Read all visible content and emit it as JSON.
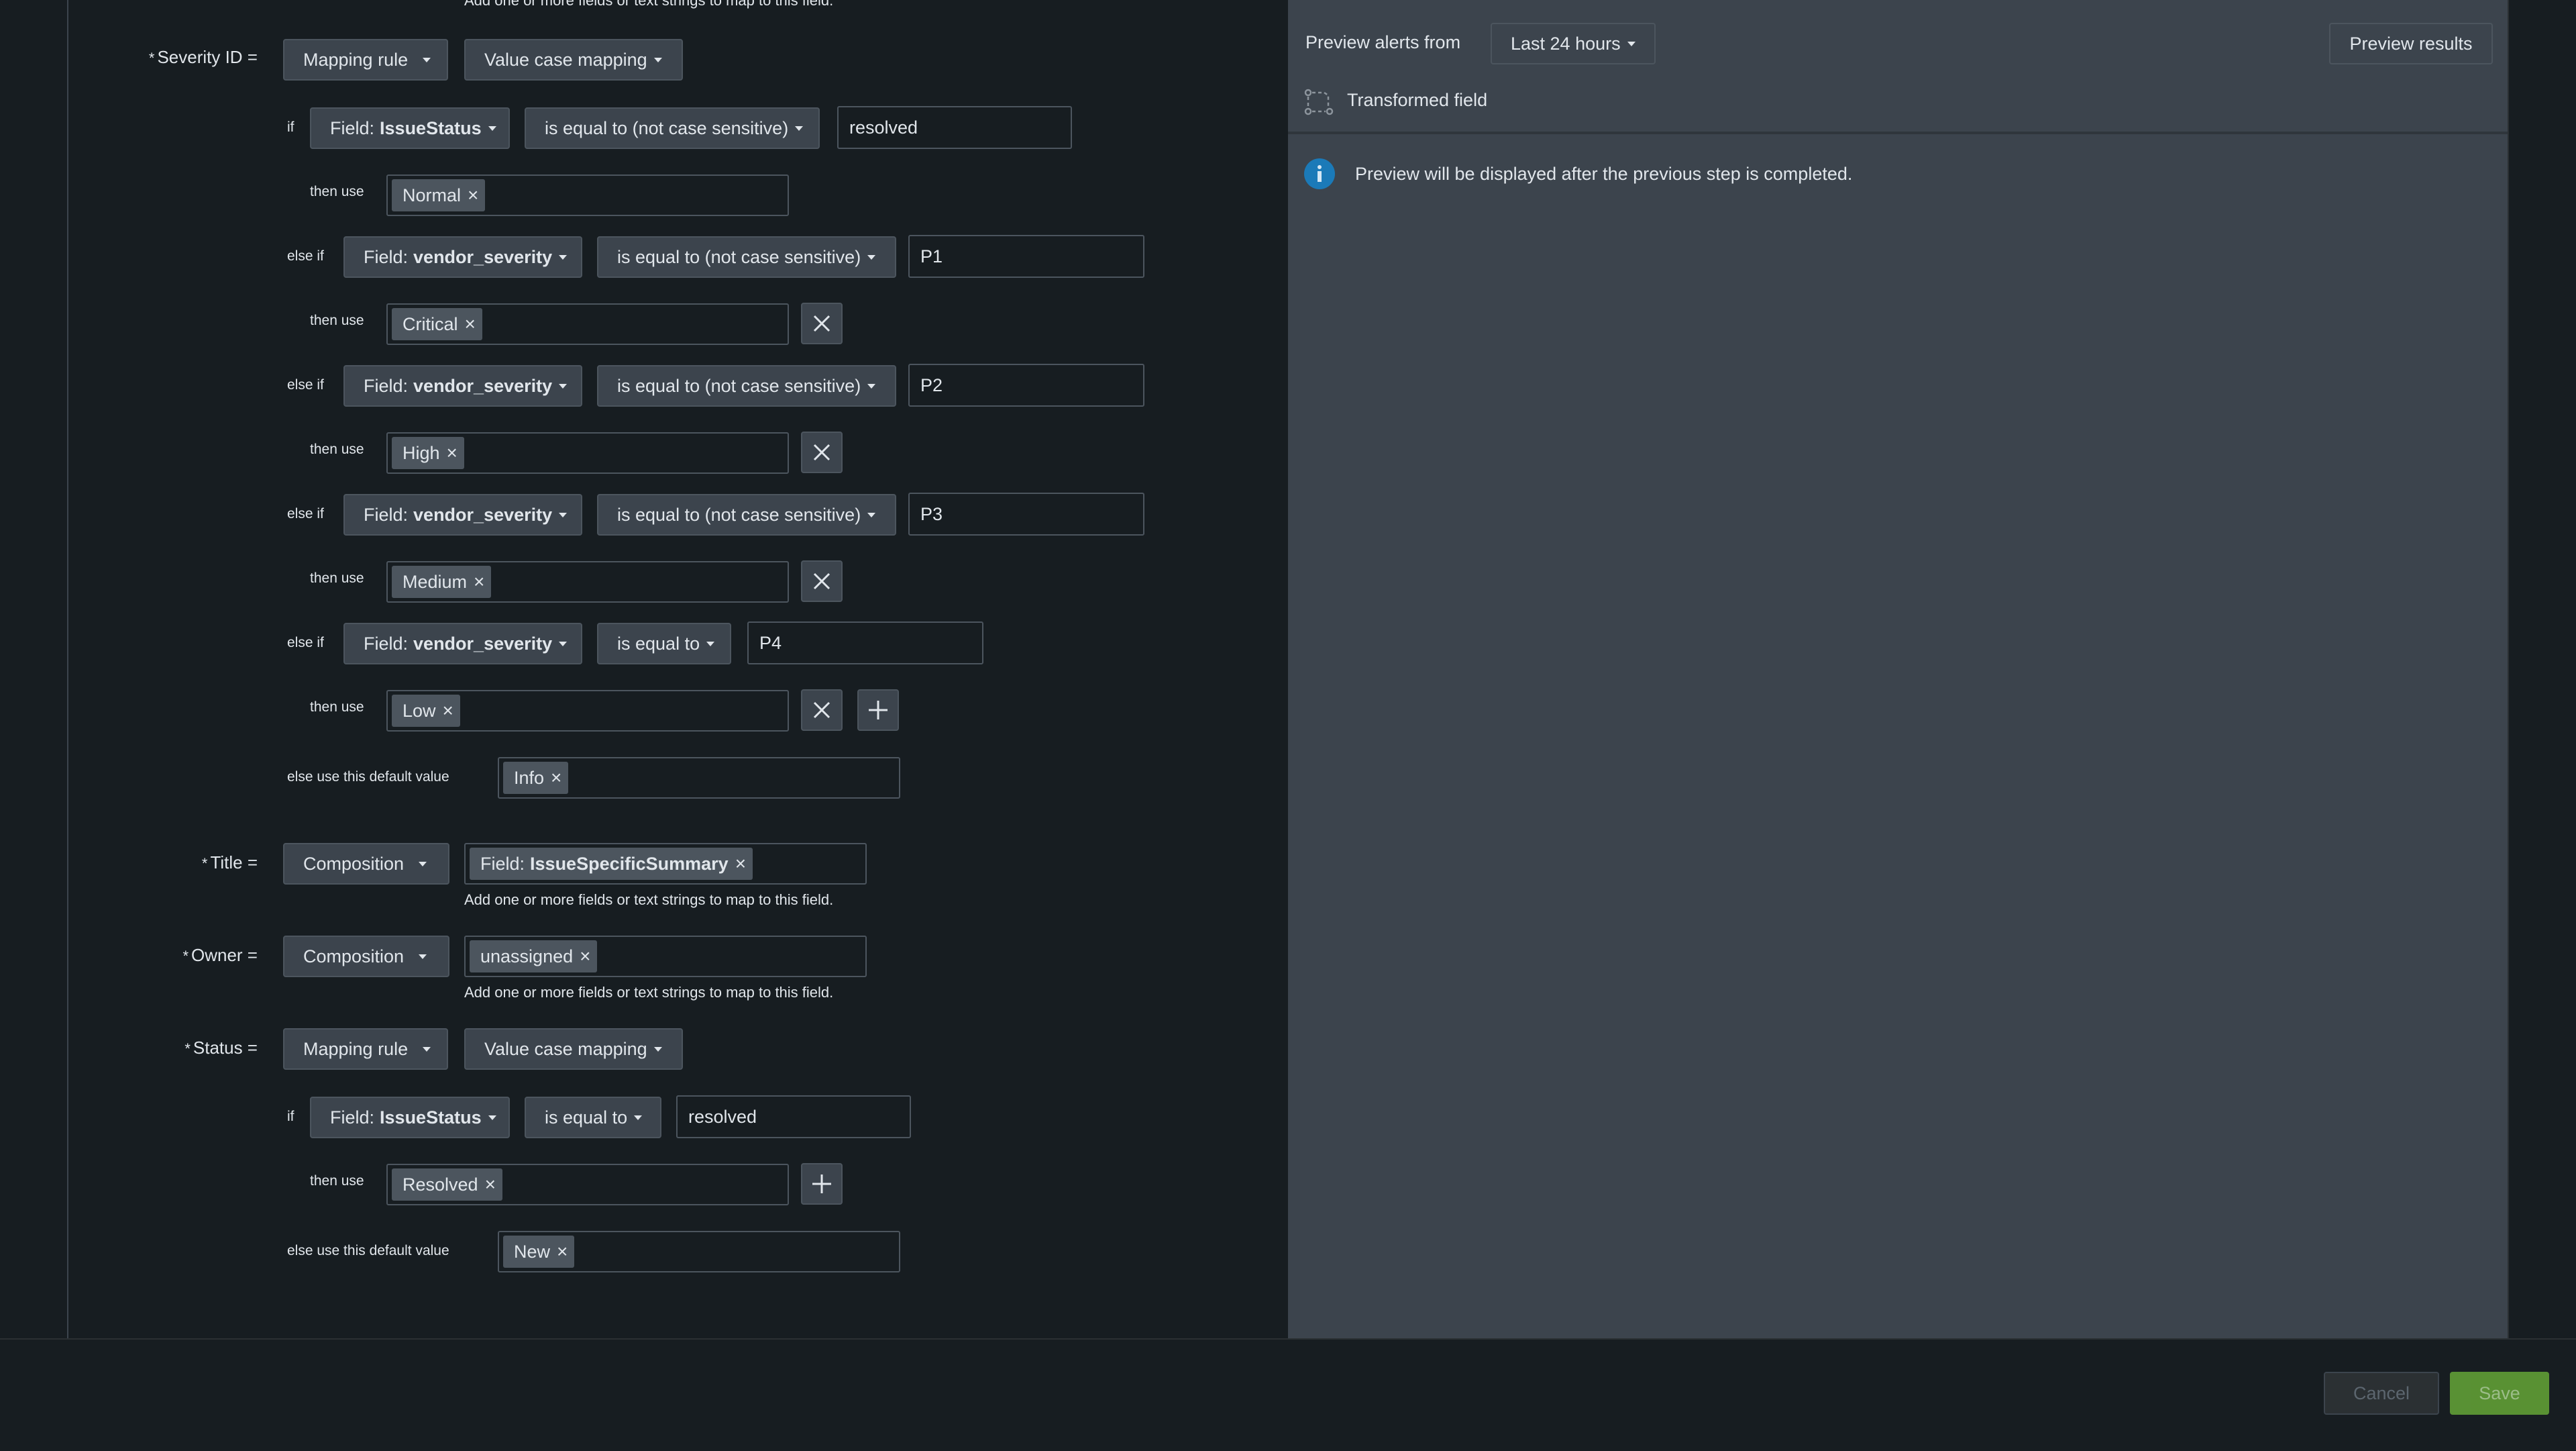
{
  "help_text": "Add one or more fields or text strings to map to this field.",
  "severity": {
    "label": "Severity ID =",
    "method": "Mapping rule",
    "mapping_type": "Value case mapping",
    "if_label": "if",
    "else_if_label": "else if",
    "then_use_label": "then use",
    "else_default_label": "else use this default value",
    "rule_field_prefix": "Field:",
    "rules": [
      {
        "field": "IssueStatus",
        "operator": "is equal to (not case sensitive)",
        "value": "resolved",
        "then": "Normal"
      },
      {
        "field": "vendor_severity",
        "operator": "is equal to (not case sensitive)",
        "value": "P1",
        "then": "Critical"
      },
      {
        "field": "vendor_severity",
        "operator": "is equal to (not case sensitive)",
        "value": "P2",
        "then": "High"
      },
      {
        "field": "vendor_severity",
        "operator": "is equal to (not case sensitive)",
        "value": "P3",
        "then": "Medium"
      },
      {
        "field": "vendor_severity",
        "operator": "is equal to",
        "value": "P4",
        "then": "Low"
      }
    ],
    "default": "Info"
  },
  "title_field": {
    "label": "Title =",
    "method": "Composition",
    "tag_prefix": "Field:",
    "tag_field": "IssueSpecificSummary"
  },
  "owner_field": {
    "label": "Owner =",
    "method": "Composition",
    "tag": "unassigned"
  },
  "status_field": {
    "label": "Status =",
    "method": "Mapping rule",
    "mapping_type": "Value case mapping",
    "rules": [
      {
        "field": "IssueStatus",
        "operator": "is equal to",
        "value": "resolved",
        "then": "Resolved"
      }
    ],
    "default": "New"
  },
  "preview": {
    "alerts_from_label": "Preview alerts from",
    "time_range": "Last 24 hours",
    "results_button": "Preview results",
    "transformed_label": "Transformed field",
    "info_message": "Preview will be displayed after the previous step is completed."
  },
  "footer": {
    "cancel": "Cancel",
    "save": "Save"
  },
  "colors": {
    "panel_bg": "#171d21",
    "preview_bg": "#3c444d",
    "info_icon": "#1b7ab8",
    "save_bg": "#65a637"
  }
}
